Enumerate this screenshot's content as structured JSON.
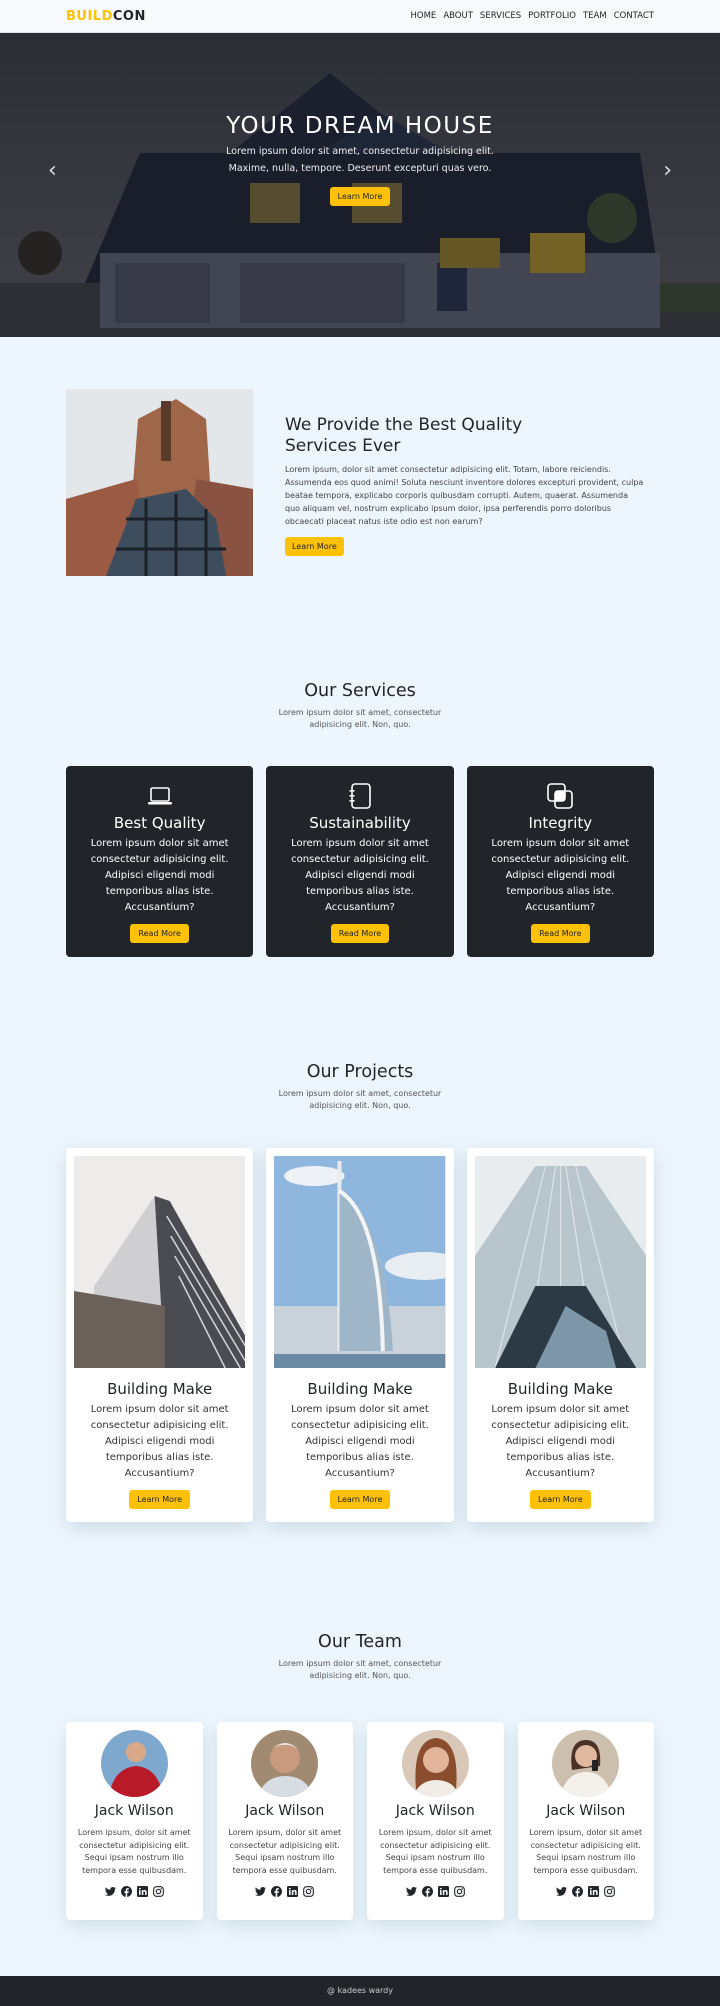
{
  "navbar": {
    "brand_part1": "BUILD",
    "brand_part2": "CON",
    "links": [
      "HOME",
      "ABOUT",
      "SERVICES",
      "PORTFOLIO",
      "TEAM",
      "CONTACT"
    ]
  },
  "hero": {
    "title": "YOUR DREAM HOUSE",
    "text_line1": "Lorem ipsum dolor sit amet, consectetur adipisicing elit.",
    "text_line2": "Maxime, nulla, tempore. Deserunt excepturi quas vero.",
    "button": "Learn More",
    "prev_icon": "‹",
    "next_icon": "›"
  },
  "about": {
    "title": "We Provide the Best Quality Services Ever",
    "text": "Lorem ipsum, dolor sit amet consectetur adipisicing elit. Totam, labore reiciendis. Assumenda eos quod animi! Soluta nesciunt inventore dolores excepturi provident, culpa beatae tempora, explicabo corporis quibusdam corrupti. Autem, quaerat. Assumenda quo aliquam vel, nostrum explicabo ipsum dolor, ipsa perferendis porro doloribus obcaecati placeat natus iste odio est non earum?",
    "button": "Learn More"
  },
  "services": {
    "title": "Our Services",
    "subtitle": "Lorem ipsum dolor sit amet, consectetur adipisicing elit. Non, quo.",
    "items": [
      {
        "icon": "laptop-icon",
        "title": "Best Quality",
        "text": "Lorem ipsum dolor sit amet consectetur adipisicing elit. Adipisci eligendi modi temporibus alias iste. Accusantium?",
        "button": "Read More"
      },
      {
        "icon": "journal-icon",
        "title": "Sustainability",
        "text": "Lorem ipsum dolor sit amet consectetur adipisicing elit. Adipisci eligendi modi temporibus alias iste. Accusantium?",
        "button": "Read More"
      },
      {
        "icon": "intersect-icon",
        "title": "Integrity",
        "text": "Lorem ipsum dolor sit amet consectetur adipisicing elit. Adipisci eligendi modi temporibus alias iste. Accusantium?",
        "button": "Read More"
      }
    ]
  },
  "projects": {
    "title": "Our Projects",
    "subtitle": "Lorem ipsum dolor sit amet, consectetur adipisicing elit. Non, quo.",
    "items": [
      {
        "title": "Building Make",
        "text": "Lorem ipsum dolor sit amet consectetur adipisicing elit. Adipisci eligendi modi temporibus alias iste. Accusantium?",
        "button": "Learn More"
      },
      {
        "title": "Building Make",
        "text": "Lorem ipsum dolor sit amet consectetur adipisicing elit. Adipisci eligendi modi temporibus alias iste. Accusantium?",
        "button": "Learn More"
      },
      {
        "title": "Building Make",
        "text": "Lorem ipsum dolor sit amet consectetur adipisicing elit. Adipisci eligendi modi temporibus alias iste. Accusantium?",
        "button": "Learn More"
      }
    ]
  },
  "team": {
    "title": "Our Team",
    "subtitle": "Lorem ipsum dolor sit amet, consectetur adipisicing elit. Non, quo.",
    "members": [
      {
        "name": "Jack Wilson",
        "text": "Lorem ipsum, dolor sit amet consectetur adipisicing elit. Sequi ipsam nostrum illo tempora esse quibusdam."
      },
      {
        "name": "Jack Wilson",
        "text": "Lorem ipsum, dolor sit amet consectetur adipisicing elit. Sequi ipsam nostrum illo tempora esse quibusdam."
      },
      {
        "name": "Jack Wilson",
        "text": "Lorem ipsum, dolor sit amet consectetur adipisicing elit. Sequi ipsam nostrum illo tempora esse quibusdam."
      },
      {
        "name": "Jack Wilson",
        "text": "Lorem ipsum, dolor sit amet consectetur adipisicing elit. Sequi ipsam nostrum illo tempora esse quibusdam."
      }
    ],
    "social_icons": [
      "twitter-icon",
      "facebook-icon",
      "linkedin-icon",
      "instagram-icon"
    ]
  },
  "footer": {
    "text": "@ kadees wardy"
  },
  "colors": {
    "accent": "#ffc107",
    "dark": "#212529",
    "background": "#eef6fd"
  }
}
